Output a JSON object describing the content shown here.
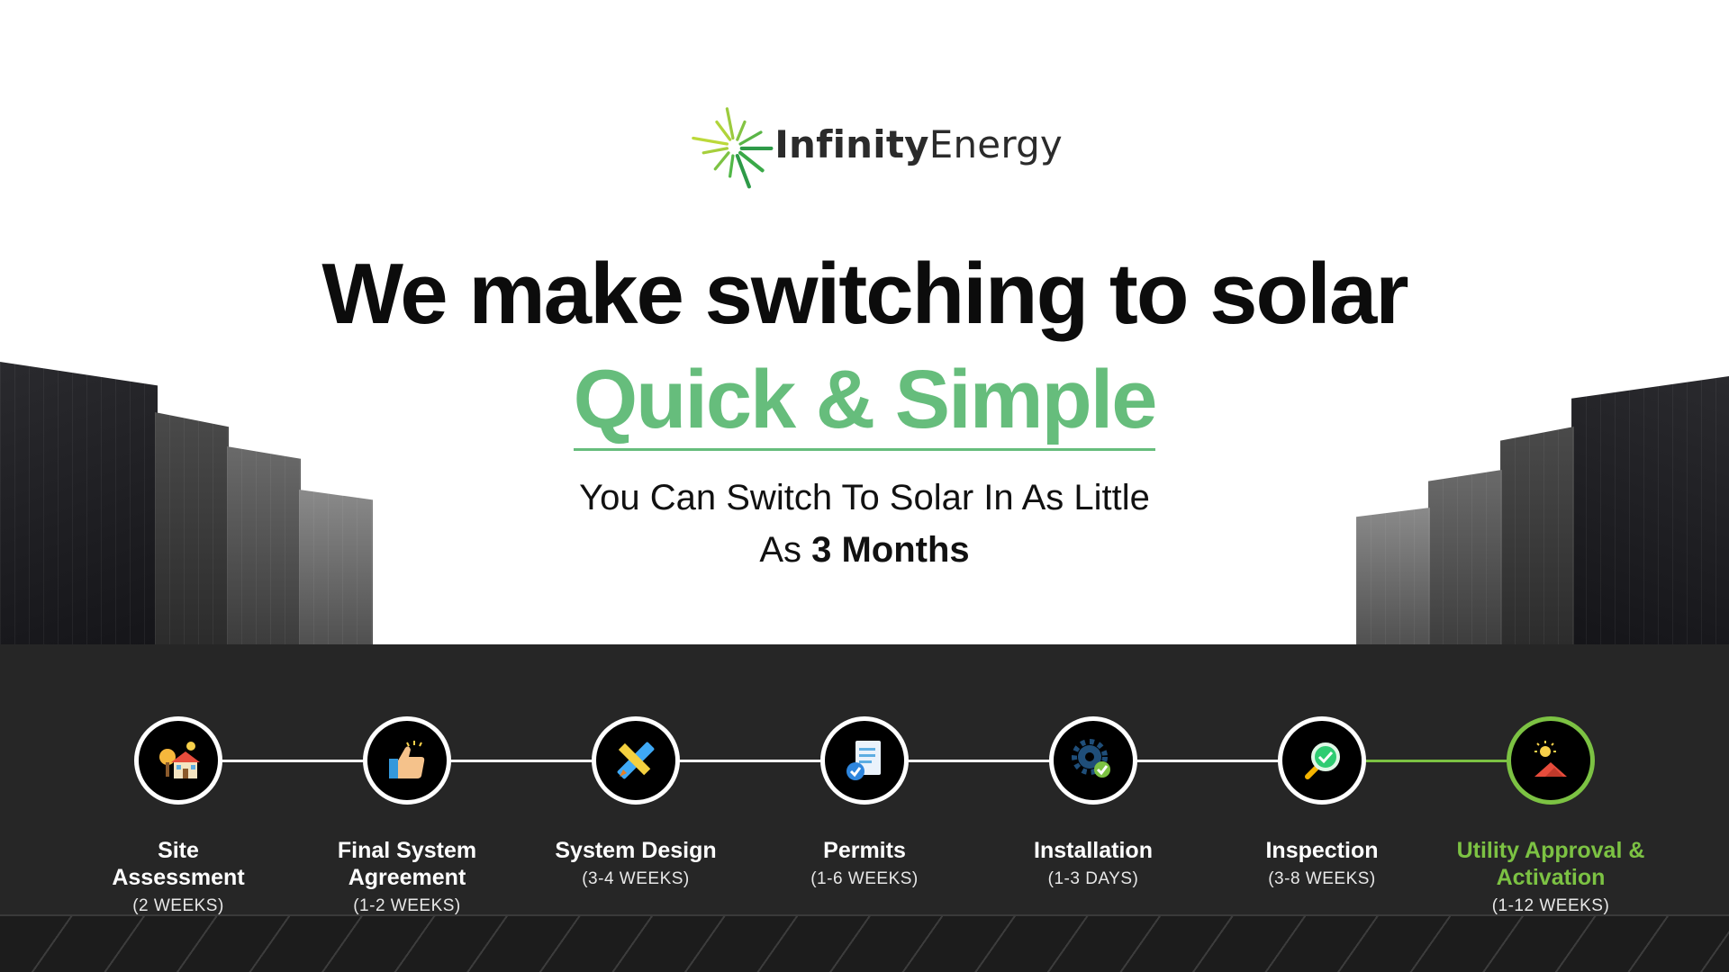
{
  "brand": {
    "name_bold": "Infinity",
    "name_light": "Energy",
    "green": "#7cc243",
    "accent_green": "#66bd7c"
  },
  "headline": "We make switching to solar",
  "subhead": "Quick & Simple",
  "tagline": {
    "line1": "You Can Switch To Solar In As Little",
    "line2_prefix": "As",
    "line2_strong": "3 Months"
  },
  "steps": [
    {
      "icon": "house-icon",
      "label_line1": "Site",
      "label_line2": "Assessment",
      "duration": "(2 WEEKS)"
    },
    {
      "icon": "thumbs-up-icon",
      "label_line1": "Final System",
      "label_line2": "Agreement",
      "duration": "(1-2 WEEKS)"
    },
    {
      "icon": "pencil-ruler-icon",
      "label_line1": "System Design",
      "label_line2": "",
      "duration": "(3-4 WEEKS)"
    },
    {
      "icon": "document-check-icon",
      "label_line1": "Permits",
      "label_line2": "",
      "duration": "(1-6 WEEKS)"
    },
    {
      "icon": "gear-check-icon",
      "label_line1": "Installation",
      "label_line2": "",
      "duration": "(1-3 DAYS)"
    },
    {
      "icon": "magnifier-check-icon",
      "label_line1": "Inspection",
      "label_line2": "",
      "duration": "(3-8 WEEKS)"
    },
    {
      "icon": "sun-house-icon",
      "label_line1": "Utility Approval &",
      "label_line2": "Activation",
      "duration": "(1-12 WEEKS)"
    }
  ]
}
